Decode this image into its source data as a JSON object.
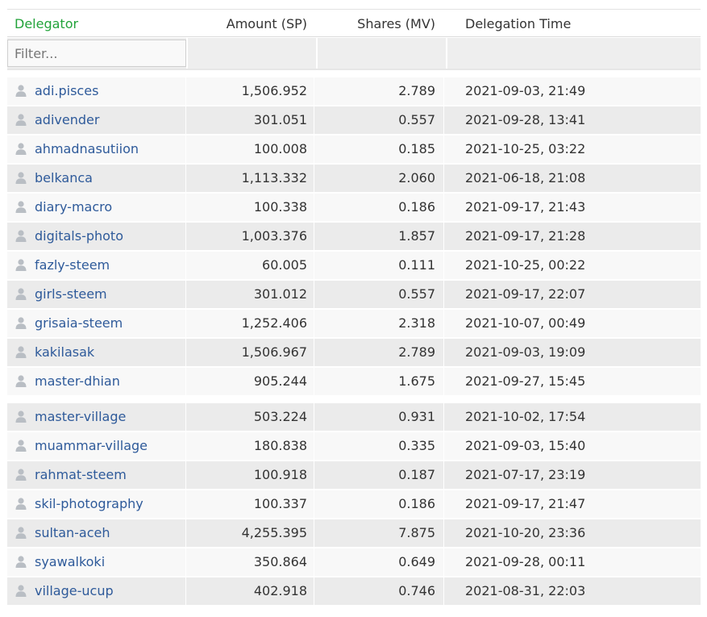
{
  "columns": {
    "delegator": "Delegator",
    "amount": "Amount (SP)",
    "shares": "Shares (MV)",
    "time": "Delegation Time"
  },
  "filter": {
    "placeholder": "Filter..."
  },
  "rows": [
    {
      "name": "adi.pisces",
      "amount": "1,506.952",
      "shares": "2.789",
      "time": "2021-09-03, 21:49"
    },
    {
      "name": "adivender",
      "amount": "301.051",
      "shares": "0.557",
      "time": "2021-09-28, 13:41"
    },
    {
      "name": "ahmadnasutiion",
      "amount": "100.008",
      "shares": "0.185",
      "time": "2021-10-25, 03:22"
    },
    {
      "name": "belkanca",
      "amount": "1,113.332",
      "shares": "2.060",
      "time": "2021-06-18, 21:08"
    },
    {
      "name": "diary-macro",
      "amount": "100.338",
      "shares": "0.186",
      "time": "2021-09-17, 21:43"
    },
    {
      "name": "digitals-photo",
      "amount": "1,003.376",
      "shares": "1.857",
      "time": "2021-09-17, 21:28"
    },
    {
      "name": "fazly-steem",
      "amount": "60.005",
      "shares": "0.111",
      "time": "2021-10-25, 00:22"
    },
    {
      "name": "girls-steem",
      "amount": "301.012",
      "shares": "0.557",
      "time": "2021-09-17, 22:07"
    },
    {
      "name": "grisaia-steem",
      "amount": "1,252.406",
      "shares": "2.318",
      "time": "2021-10-07, 00:49"
    },
    {
      "name": "kakilasak",
      "amount": "1,506.967",
      "shares": "2.789",
      "time": "2021-09-03, 19:09"
    },
    {
      "name": "master-dhian",
      "amount": "905.244",
      "shares": "1.675",
      "time": "2021-09-27, 15:45"
    },
    {
      "name": "master-village",
      "amount": "503.224",
      "shares": "0.931",
      "time": "2021-10-02, 17:54"
    },
    {
      "name": "muammar-village",
      "amount": "180.838",
      "shares": "0.335",
      "time": "2021-09-03, 15:40"
    },
    {
      "name": "rahmat-steem",
      "amount": "100.918",
      "shares": "0.187",
      "time": "2021-07-17, 23:19"
    },
    {
      "name": "skil-photography",
      "amount": "100.337",
      "shares": "0.186",
      "time": "2021-09-17, 21:47"
    },
    {
      "name": "sultan-aceh",
      "amount": "4,255.395",
      "shares": "7.875",
      "time": "2021-10-20, 23:36"
    },
    {
      "name": "syawalkoki",
      "amount": "350.864",
      "shares": "0.649",
      "time": "2021-09-28, 00:11"
    },
    {
      "name": "village-ucup",
      "amount": "402.918",
      "shares": "0.746",
      "time": "2021-08-31, 22:03"
    }
  ],
  "colors": {
    "header_accent": "#22a33a",
    "link": "#2e5a9a",
    "row_light": "#f8f8f8",
    "row_dark": "#ebebeb"
  },
  "icons": {
    "user": "user-icon"
  }
}
